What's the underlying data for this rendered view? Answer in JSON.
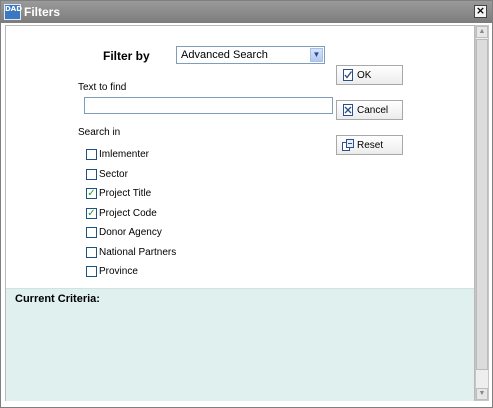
{
  "window": {
    "title": "Filters",
    "app_icon_text": "DAD",
    "close_glyph": "×"
  },
  "form": {
    "filter_by_label": "Filter by",
    "filter_by_value": "Advanced Search",
    "text_to_find_label": "Text to find",
    "text_to_find_value": "",
    "search_in_label": "Search in",
    "search_in_options": [
      {
        "label": "Imlementer",
        "checked": false
      },
      {
        "label": "Sector",
        "checked": false
      },
      {
        "label": "Project Title",
        "checked": true
      },
      {
        "label": "Project Code",
        "checked": true
      },
      {
        "label": "Donor Agency",
        "checked": false
      },
      {
        "label": "National Partners",
        "checked": false
      },
      {
        "label": "Province",
        "checked": false
      }
    ]
  },
  "buttons": {
    "ok_label": "OK",
    "cancel_label": "Cancel",
    "reset_label": "Reset"
  },
  "criteria": {
    "title": "Current Criteria:"
  },
  "icons": {
    "app": "dad-app-icon",
    "close": "close-icon",
    "dropdown": "chevron-down-icon",
    "ok": "check-document-icon",
    "cancel": "cancel-document-icon",
    "reset": "reset-icon"
  },
  "colors": {
    "titlebar": "#8a8a8a",
    "criteria_background": "#dff0ee",
    "checkmark": "#21a121"
  }
}
